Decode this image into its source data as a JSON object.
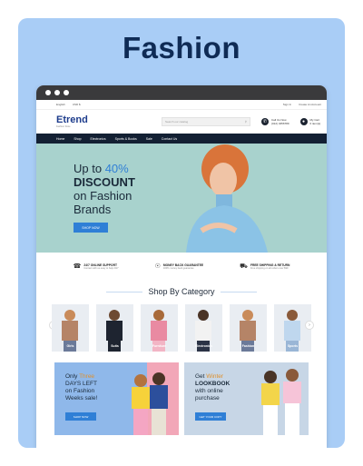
{
  "card": {
    "title": "Fashion"
  },
  "topbar": {
    "language": "English",
    "currency": "USD $",
    "sign_in": "Sign In",
    "create_account": "Create An Account"
  },
  "header": {
    "logo": "Etrend",
    "logo_sub": "Fashion Store",
    "search_placeholder": "Search our catalog",
    "help_title": "Call Us Now",
    "help_phone": "(012) 3456789",
    "cart_title": "My Cart",
    "cart_count": "0 item(s)"
  },
  "nav": [
    "Home",
    "Shop",
    "Electronics",
    "Sports & Books",
    "Sale",
    "Contact Us"
  ],
  "hero": {
    "line1a": "Up to ",
    "line1b": "40%",
    "line2": "DISCOUNT",
    "line3": "on Fashion",
    "line4": "Brands",
    "button": "SHOP NOW"
  },
  "features": [
    {
      "title": "24/7 ONLINE SUPPORT",
      "sub": "Contact with us easy to help 24/7"
    },
    {
      "title": "MONEY BACK GUARANTEE",
      "sub": "100% money back guarantee"
    },
    {
      "title": "FREE SHIPPING & RETURN",
      "sub": "Free shipping on all orders over $99"
    }
  ],
  "section_title": "Shop By Category",
  "categories": [
    "Girls",
    "Suits",
    "Furniture",
    "Electronics",
    "Fashion",
    "Sports"
  ],
  "promos": [
    {
      "a": "Only ",
      "b": "Three",
      "c": "DAYS LEFT",
      "d": "on Fashion",
      "e": "Weeks sale!",
      "button": "SHOP NOW"
    },
    {
      "a": "Get ",
      "b": "Winter",
      "c": "LOOKBOOK",
      "d": "with online",
      "e": "purchase",
      "button": "GET YOUR COPY"
    }
  ],
  "colors": {
    "card_bg": "#a9cdf6",
    "accent": "#2f7fd6",
    "nav_bg": "#132033",
    "hero_bg": "#a8d2cd"
  }
}
